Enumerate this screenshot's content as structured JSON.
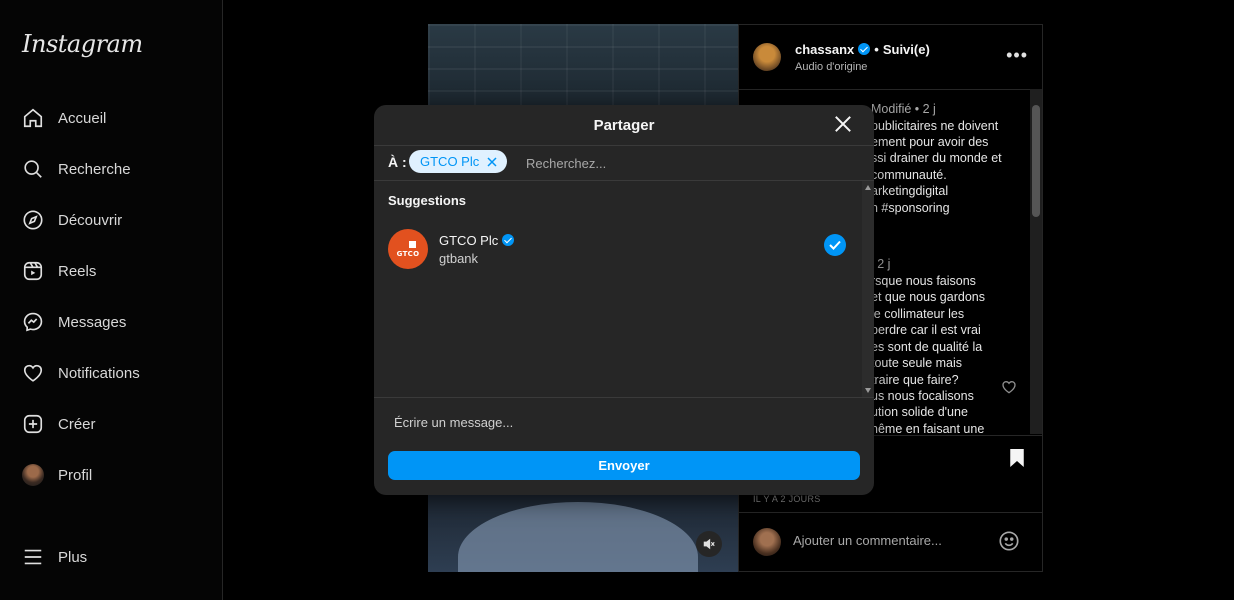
{
  "app": {
    "logo_text": "Instagram"
  },
  "sidebar": {
    "items": [
      {
        "label": "Accueil",
        "icon": "home-icon"
      },
      {
        "label": "Recherche",
        "icon": "search-icon"
      },
      {
        "label": "Découvrir",
        "icon": "compass-icon"
      },
      {
        "label": "Reels",
        "icon": "reels-icon"
      },
      {
        "label": "Messages",
        "icon": "messenger-icon"
      },
      {
        "label": "Notifications",
        "icon": "heart-icon"
      },
      {
        "label": "Créer",
        "icon": "plus-square-icon"
      },
      {
        "label": "Profil",
        "icon": "avatar"
      }
    ],
    "more_label": "Plus"
  },
  "post": {
    "author": "chassanx",
    "separator": "•",
    "follow_state": "Suivi(e)",
    "audio": "Audio d'origine",
    "more": "•••",
    "comments": [
      {
        "text": "Modifié • 2 j",
        "meta": true
      },
      {
        "text": "publicitaires ne doivent"
      },
      {
        "text": "ement pour avoir des"
      },
      {
        "text": "ssi drainer du monde et"
      },
      {
        "text": "communauté."
      },
      {
        "text": "arketingdigital"
      },
      {
        "text": "n #sponsoring"
      },
      {
        "text": "l 2 j",
        "meta": true
      },
      {
        "text": "rsque nous faisons"
      },
      {
        "text": "et que nous gardons"
      },
      {
        "text": "le collimateur les"
      },
      {
        "text": "perdre car il est vrai"
      },
      {
        "text": "es sont de qualité la"
      },
      {
        "text": "toute seule mais"
      },
      {
        "text": "traire que faire?"
      },
      {
        "text": "us nous focalisons"
      },
      {
        "text": "ution solide d'une"
      },
      {
        "text": "nême en faisant une"
      }
    ],
    "time_ago": "IL Y A 2 JOURS",
    "comment_placeholder": "Ajouter un commentaire..."
  },
  "share_modal": {
    "title": "Partager",
    "to_label": "À :",
    "chip_label": "GTCO Plc",
    "search_placeholder": "Recherchez...",
    "suggestions_title": "Suggestions",
    "suggestions": [
      {
        "name": "GTCO Plc",
        "username": "gtbank",
        "avatar_text": "GTCO",
        "verified": true,
        "selected": true
      }
    ],
    "message_placeholder": "Écrire un message...",
    "send_label": "Envoyer"
  },
  "colors": {
    "accent": "#0095f6",
    "background": "#000000",
    "modal": "#262626",
    "gtco_brand": "#e2511f"
  }
}
